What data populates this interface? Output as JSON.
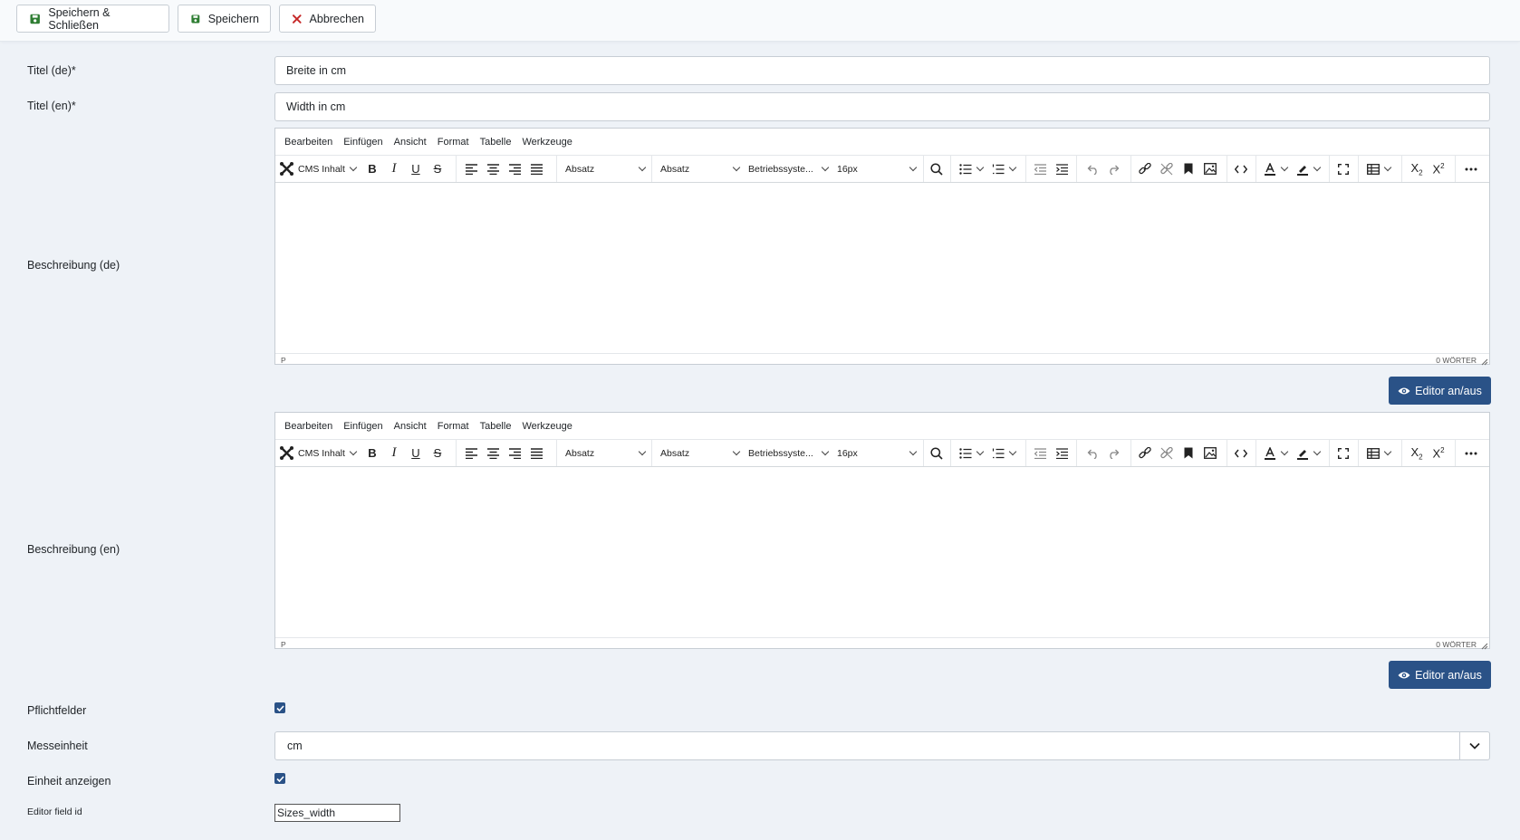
{
  "toolbar": {
    "save_close_label": "Speichern & Schließen",
    "save_label": "Speichern",
    "cancel_label": "Abbrechen"
  },
  "fields": {
    "title_de": {
      "label": "Titel (de)*",
      "value": "Breite in cm"
    },
    "title_en": {
      "label": "Titel (en)*",
      "value": "Width in cm"
    },
    "desc_de": {
      "label": "Beschreibung (de)"
    },
    "desc_en": {
      "label": "Beschreibung (en)"
    },
    "required": {
      "label": "Pflichtfelder",
      "checked": true
    },
    "unit": {
      "label": "Messeinheit",
      "value": "cm"
    },
    "show_unit": {
      "label": "Einheit anzeigen",
      "checked": true
    },
    "editor_field_id": {
      "label": "Editor field id",
      "value": "Sizes_width"
    }
  },
  "editor": {
    "menu": [
      "Bearbeiten",
      "Einfügen",
      "Ansicht",
      "Format",
      "Tabelle",
      "Werkzeuge"
    ],
    "cms_label": "CMS Inhalt",
    "block_format": "Absatz",
    "style_format": "Absatz",
    "font_family": "Betriebssyste...",
    "font_size": "16px",
    "status_path": "P",
    "word_count": "0 WÖRTER",
    "toggle_label": "Editor an/aus"
  },
  "colors": {
    "accent": "#2a5287",
    "save_icon": "#2e7d32",
    "cancel_icon": "#c62828"
  }
}
